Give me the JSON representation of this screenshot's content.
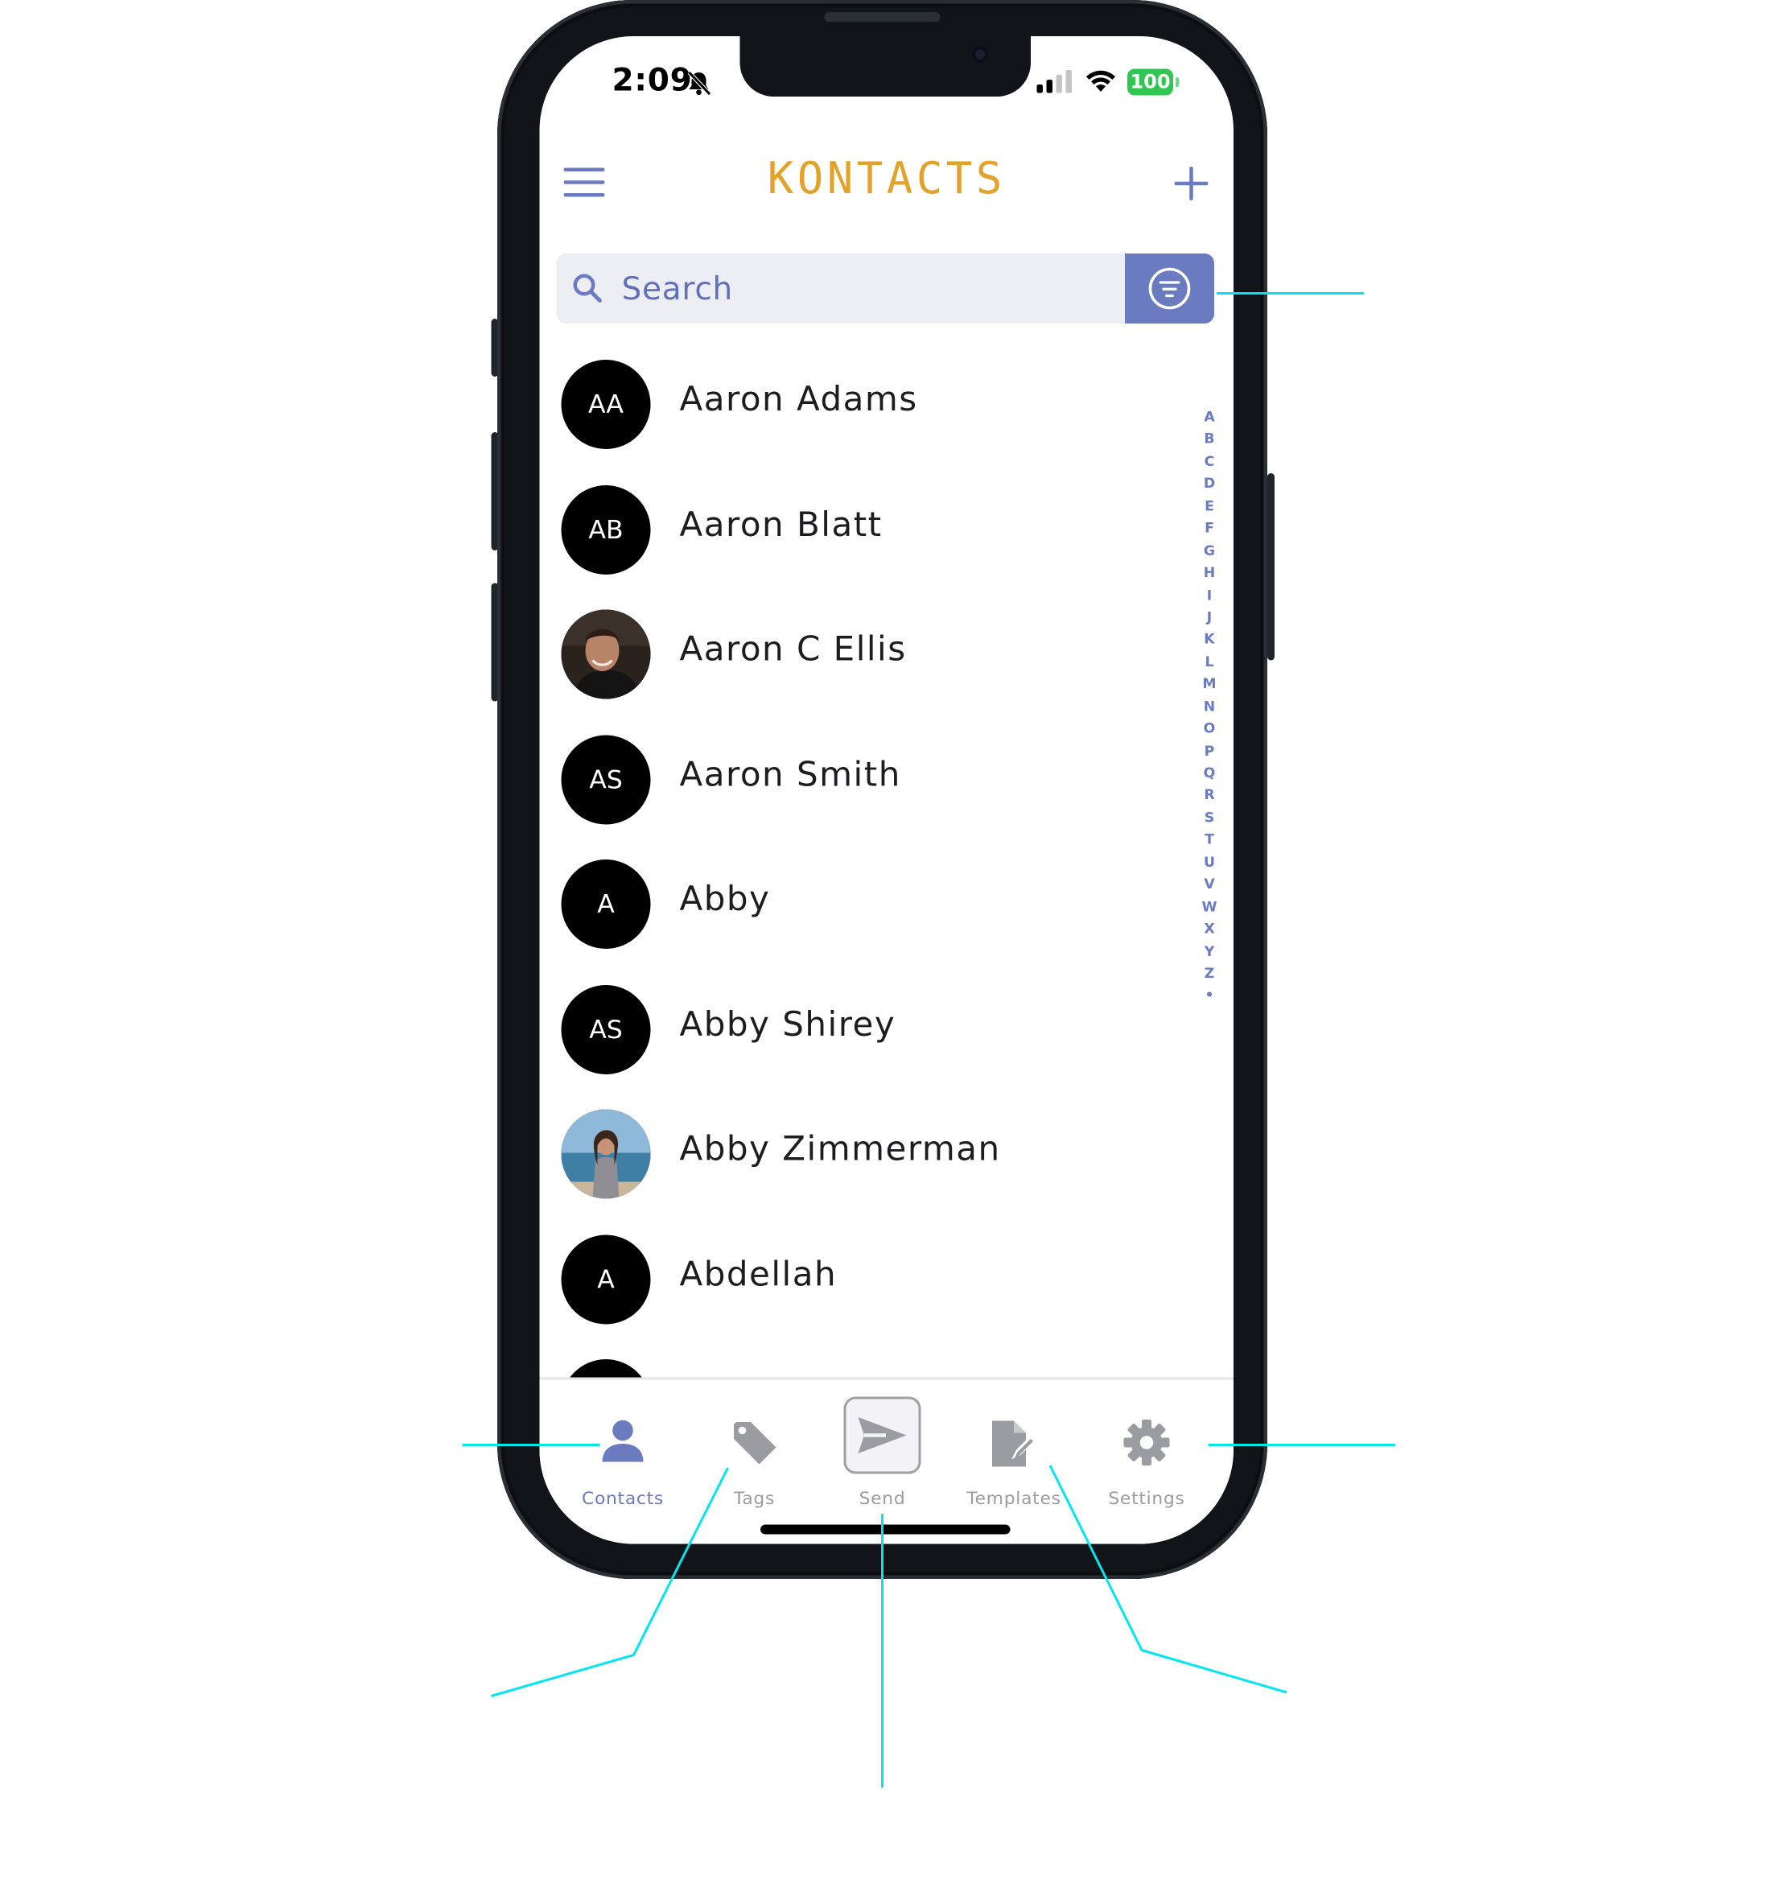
{
  "status_bar": {
    "time": "2:09",
    "battery": "100"
  },
  "header": {
    "title": "KONTACTS"
  },
  "search": {
    "placeholder": "Search"
  },
  "contacts": [
    {
      "initials": "AA",
      "name": "Aaron Adams",
      "photo": false
    },
    {
      "initials": "AB",
      "name": "Aaron Blatt",
      "photo": false
    },
    {
      "initials": "",
      "name": "Aaron C Ellis",
      "photo": true
    },
    {
      "initials": "AS",
      "name": "Aaron Smith",
      "photo": false
    },
    {
      "initials": "A",
      "name": "Abby",
      "photo": false
    },
    {
      "initials": "AS",
      "name": "Abby Shirey",
      "photo": false
    },
    {
      "initials": "",
      "name": "Abby Zimmerman",
      "photo": true
    },
    {
      "initials": "A",
      "name": "Abdellah",
      "photo": false
    }
  ],
  "alpha_index": [
    "A",
    "B",
    "C",
    "D",
    "E",
    "F",
    "G",
    "H",
    "I",
    "J",
    "K",
    "L",
    "M",
    "N",
    "O",
    "P",
    "Q",
    "R",
    "S",
    "T",
    "U",
    "V",
    "W",
    "X",
    "Y",
    "Z",
    "•"
  ],
  "tabs": [
    {
      "label": "Contacts",
      "icon": "person-icon",
      "active": true
    },
    {
      "label": "Tags",
      "icon": "tag-icon",
      "active": false
    },
    {
      "label": "Send",
      "icon": "send-icon",
      "active": false
    },
    {
      "label": "Templates",
      "icon": "template-edit-icon",
      "active": false
    },
    {
      "label": "Settings",
      "icon": "gear-icon",
      "active": false
    }
  ],
  "colors": {
    "accent": "#6b7bbf",
    "brand_title": "#e2a32b",
    "callout_line": "#00e5ee",
    "avatar_bg": "#000000",
    "battery": "#2fc752"
  }
}
